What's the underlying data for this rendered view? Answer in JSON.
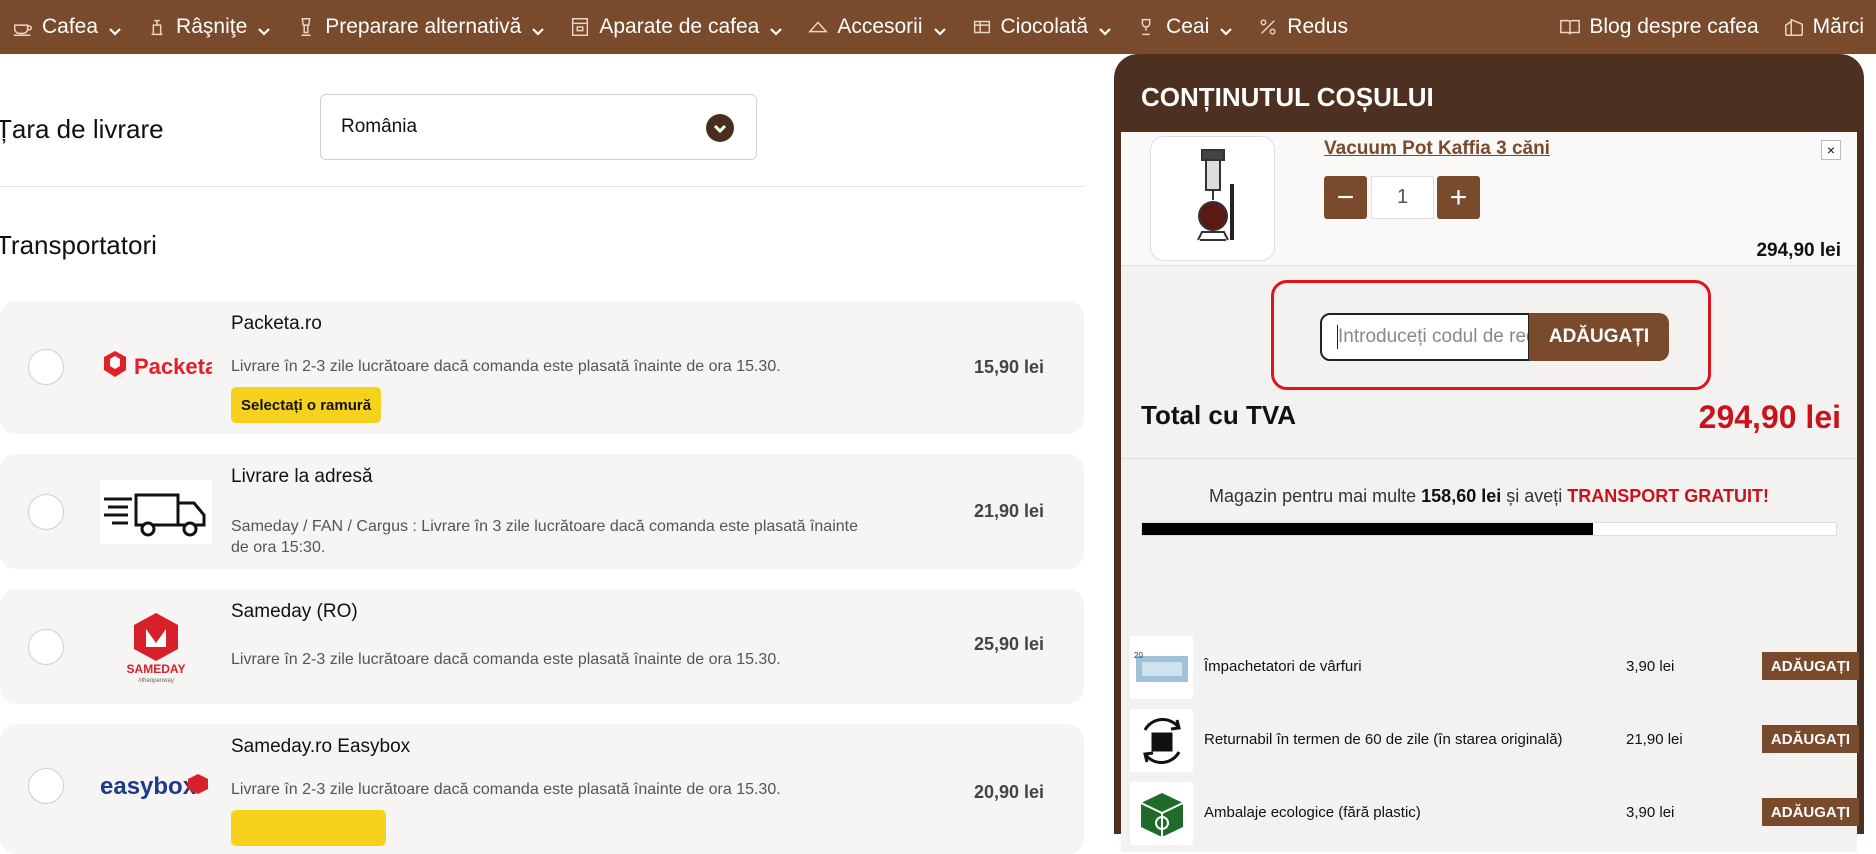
{
  "nav": {
    "items": [
      {
        "label": "Cafea",
        "icon": "coffee-cup-icon"
      },
      {
        "label": "Râşniţe",
        "icon": "grinder-icon"
      },
      {
        "label": "Preparare alternativă",
        "icon": "brewer-icon"
      },
      {
        "label": "Aparate de cafea",
        "icon": "espresso-machine-icon"
      },
      {
        "label": "Accesorii",
        "icon": "accessories-icon"
      },
      {
        "label": "Ciocolată",
        "icon": "chocolate-icon"
      },
      {
        "label": "Ceai",
        "icon": "tea-icon"
      },
      {
        "label": "Redus",
        "icon": "percent-icon"
      }
    ],
    "right_items": [
      {
        "label": "Blog despre cafea",
        "icon": "book-icon"
      },
      {
        "label": "Mărci",
        "icon": "brands-icon"
      }
    ]
  },
  "shipping": {
    "country_label": "Țara de livrare",
    "country_value": "România",
    "carriers_title": "Transportatori"
  },
  "carriers": [
    {
      "name": "Packeta.ro",
      "logo_text": "Packeta",
      "desc": "Livrare în 2-3 zile lucrătoare dacă comanda este plasată înainte de ora 15.30.",
      "price": "15,90 lei",
      "button": "Selectați o ramură"
    },
    {
      "name": "Livrare la adresă",
      "desc": "Sameday / FAN / Cargus : Livrare în 3 zile lucrătoare dacă comanda este plasată înainte de ora 15:30.",
      "price": "21,90 lei"
    },
    {
      "name": "Sameday (RO)",
      "logo_text": "SAMEDAY",
      "logo_sub": "#theopenway",
      "desc": "Livrare în 2-3 zile lucrătoare dacă comanda este plasată înainte de ora 15.30.",
      "price": "25,90 lei"
    },
    {
      "name": "Sameday.ro Easybox",
      "logo_text": "easybox",
      "desc": "Livrare în 2-3 zile lucrătoare dacă comanda este plasată înainte de ora 15.30.",
      "price": "20,90 lei"
    }
  ],
  "cart": {
    "title": "CONȚINUTUL COȘULUI",
    "item": {
      "name": "Vacuum Pot Kaffia 3 căni",
      "qty": "1",
      "price": "294,90 lei",
      "remove": "×"
    },
    "coupon": {
      "placeholder": "Introduceți codul de reducere",
      "button": "ADĂUGAȚI"
    },
    "total_label": "Total cu TVA",
    "total_value": "294,90 lei",
    "free_shipping": {
      "prefix": "Magazin pentru mai multe",
      "amount": "158,60 lei",
      "middle": "și aveți",
      "highlight": "TRANSPORT GRATUIT!"
    },
    "progress_fraction": 0.65,
    "addons": [
      {
        "name": "Împachetatori de vârfuri",
        "price": "3,90 lei",
        "button": "ADĂUGAȚI",
        "icon": "tip-wrapper-icon",
        "thumb_text": "20"
      },
      {
        "name": "Returnabil în termen de 60 de zile (în starea originală)",
        "price": "21,90 lei",
        "button": "ADĂUGAȚI",
        "icon": "return-icon"
      },
      {
        "name": "Ambalaje ecologice (fără plastic)",
        "price": "3,90 lei",
        "button": "ADĂUGAȚI",
        "icon": "eco-package-icon"
      }
    ]
  },
  "colors": {
    "nav_bg": "#7a4a2d",
    "cart_header": "#4d3020",
    "accent": "#7a4a2d",
    "price_red": "#c8121c",
    "highlight_border": "#e0141e",
    "packeta_yellow": "#f6d21c"
  }
}
